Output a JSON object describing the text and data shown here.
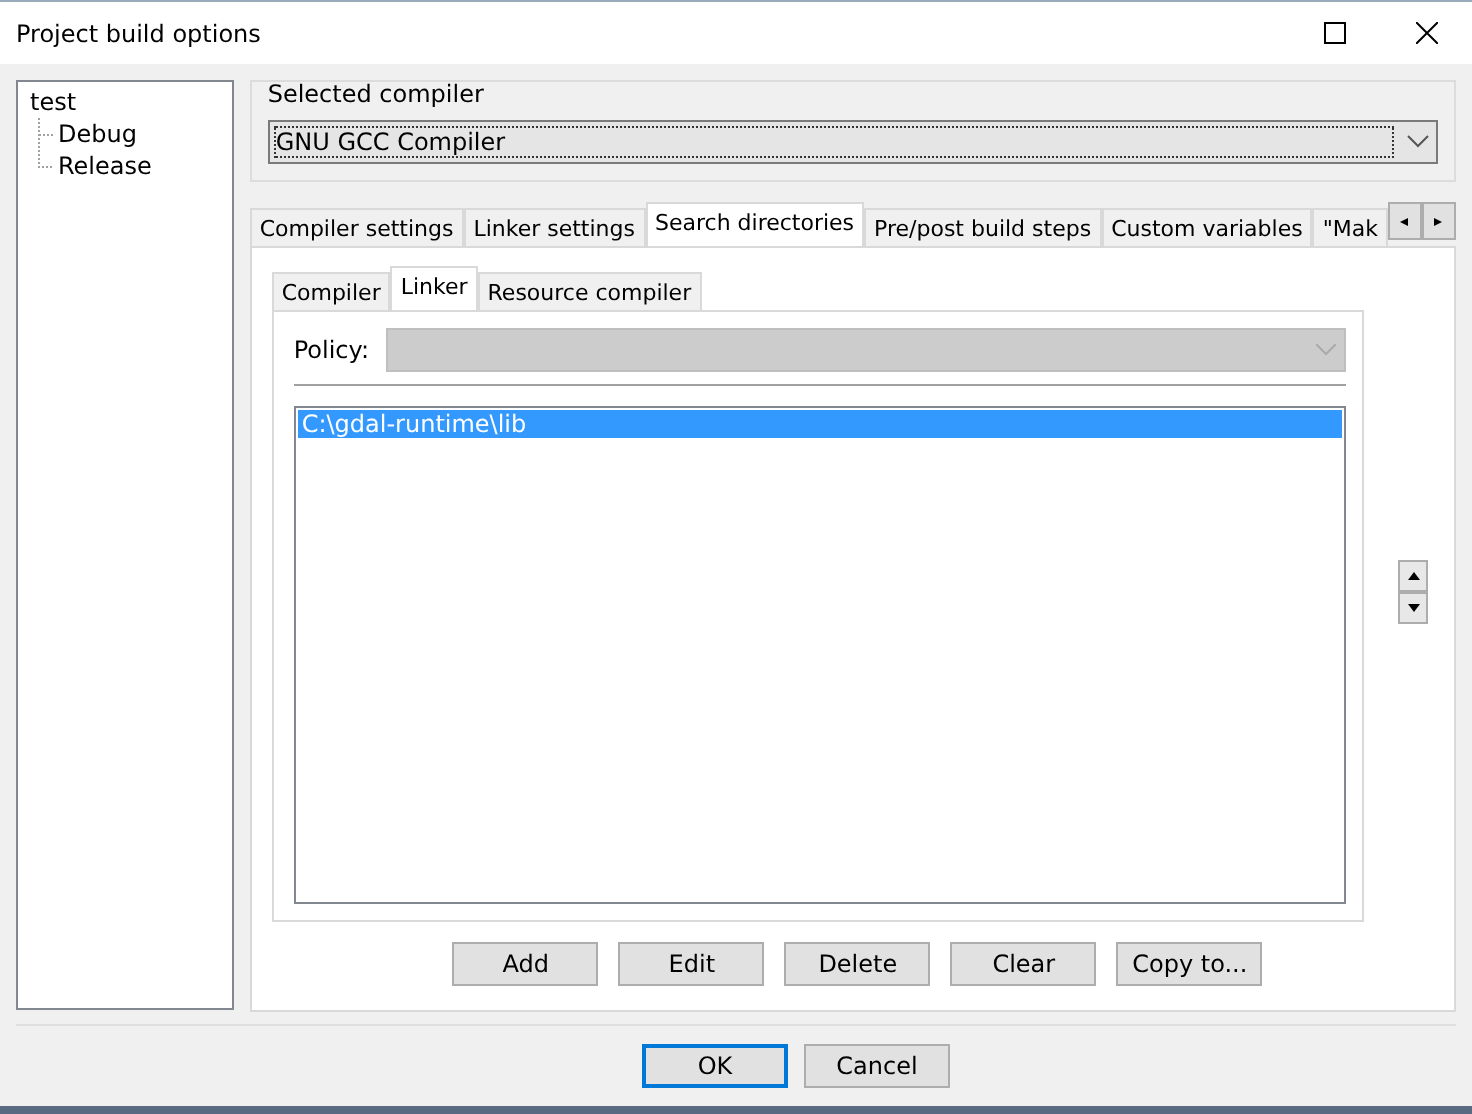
{
  "window": {
    "title": "Project build options"
  },
  "tree": {
    "label": "test",
    "children": [
      {
        "label": "Debug",
        "selected": false
      },
      {
        "label": "Release",
        "selected": false
      }
    ]
  },
  "compiler_group": {
    "label": "Selected compiler",
    "value": "GNU GCC Compiler"
  },
  "tabs": [
    {
      "label": "Compiler settings",
      "selected": false
    },
    {
      "label": "Linker settings",
      "selected": false
    },
    {
      "label": "Search directories",
      "selected": true
    },
    {
      "label": "Pre/post build steps",
      "selected": false
    },
    {
      "label": "Custom variables",
      "selected": false
    },
    {
      "label": "\"Mak",
      "selected": false
    }
  ],
  "sub_tabs": [
    {
      "label": "Compiler",
      "selected": false
    },
    {
      "label": "Linker",
      "selected": true
    },
    {
      "label": "Resource compiler",
      "selected": false
    }
  ],
  "policy": {
    "label": "Policy:",
    "disabled": true
  },
  "directories": [
    {
      "path": "C:\\gdal-runtime\\lib",
      "selected": true
    }
  ],
  "buttons": [
    "Add",
    "Edit",
    "Delete",
    "Clear",
    "Copy to..."
  ],
  "dialog_buttons": [
    {
      "label": "OK",
      "default": true
    },
    {
      "label": "Cancel",
      "default": false
    }
  ]
}
